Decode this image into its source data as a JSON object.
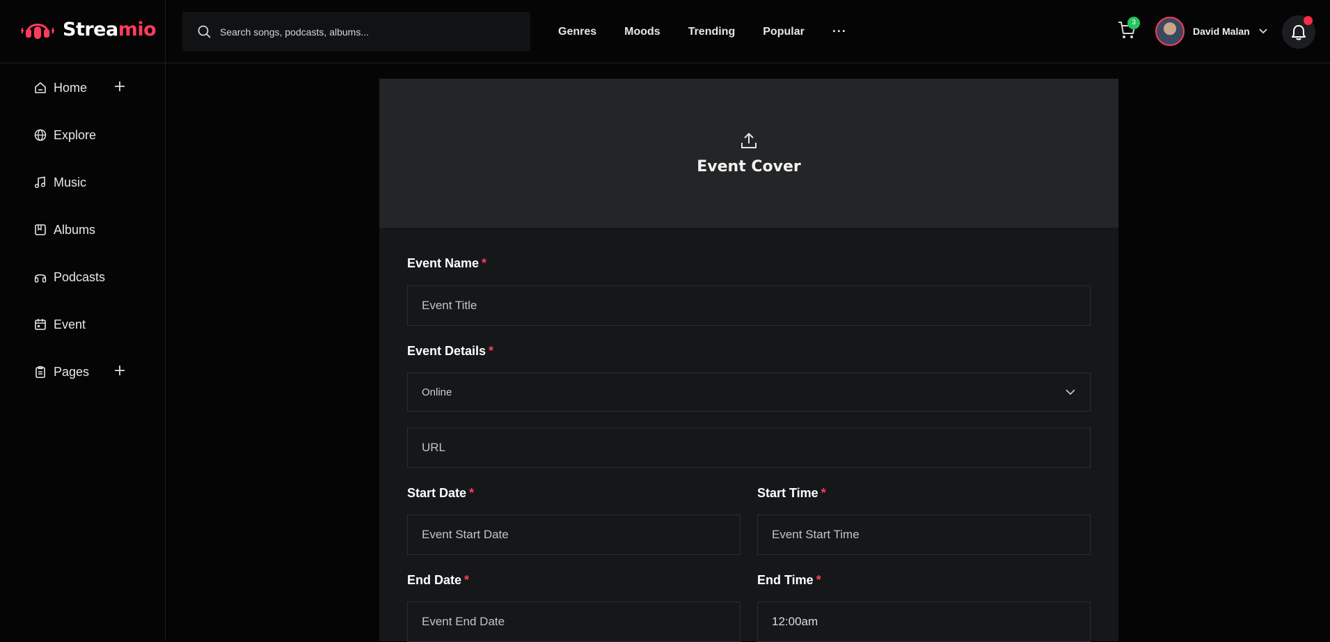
{
  "brand": {
    "name_part1": "Strea",
    "name_part2": "mio"
  },
  "search": {
    "placeholder": "Search songs, podcasts, albums..."
  },
  "nav": {
    "items": [
      "Genres",
      "Moods",
      "Trending",
      "Popular"
    ],
    "more": "···"
  },
  "cart": {
    "count": "3"
  },
  "user": {
    "name": "David Malan"
  },
  "sidebar": {
    "items": [
      {
        "label": "Home",
        "icon": "home-icon"
      },
      {
        "label": "Explore",
        "icon": "globe-icon"
      },
      {
        "label": "Music",
        "icon": "music-note-icon"
      },
      {
        "label": "Albums",
        "icon": "album-icon"
      },
      {
        "label": "Podcasts",
        "icon": "headphones-icon"
      },
      {
        "label": "Event",
        "icon": "calendar-icon"
      },
      {
        "label": "Pages",
        "icon": "clipboard-icon"
      }
    ]
  },
  "form": {
    "cover_title": "Event Cover",
    "event_name": {
      "label": "Event Name",
      "required": "*",
      "placeholder": "Event Title"
    },
    "event_details": {
      "label": "Event Details",
      "required": "*",
      "selected": "Online"
    },
    "url": {
      "placeholder": "URL"
    },
    "start_date": {
      "label": "Start Date",
      "required": "*",
      "placeholder": "Event Start Date"
    },
    "start_time": {
      "label": "Start Time",
      "required": "*",
      "placeholder": "Event Start Time"
    },
    "end_date": {
      "label": "End Date",
      "required": "*",
      "placeholder": "Event End Date"
    },
    "end_time": {
      "label": "End Time",
      "required": "*",
      "value": "12:00am"
    }
  },
  "colors": {
    "accent": "#ff3b5c",
    "badge": "#22c55e",
    "card": "#151719",
    "cover": "#242527"
  }
}
